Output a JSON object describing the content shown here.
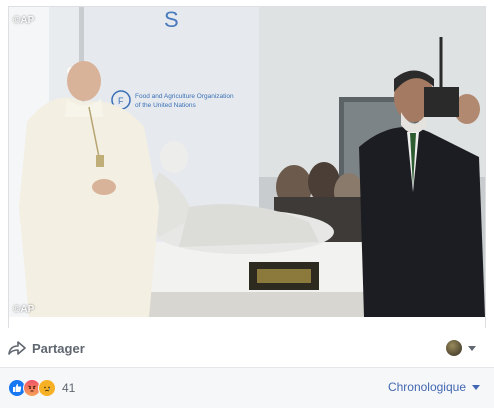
{
  "photo": {
    "watermark_top": "©AP",
    "watermark_bottom": "©AP",
    "banner_line1": "Food and Agriculture Organization",
    "banner_line2": "of the United Nations"
  },
  "actions": {
    "share_label": "Partager"
  },
  "reactions": {
    "count": "41",
    "icons": [
      "like-icon",
      "angry-icon",
      "sad-icon"
    ]
  },
  "comments": {
    "sort_label": "Chronologique"
  },
  "colors": {
    "accent": "#4267b2",
    "muted_text": "#606770",
    "like": "#1877f2",
    "angry": "#f25268",
    "sad": "#f7b125"
  }
}
